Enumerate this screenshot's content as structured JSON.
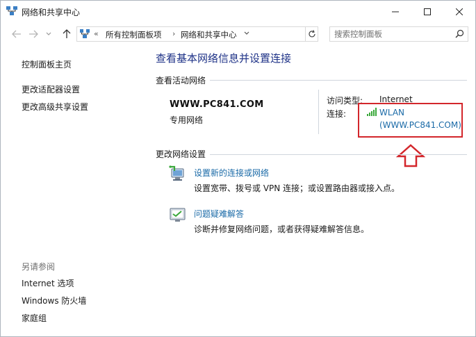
{
  "window": {
    "title": "网络和共享中心",
    "controls": [
      "minimize",
      "maximize",
      "close"
    ]
  },
  "address": {
    "overflow": "«",
    "crumbs": [
      "所有控制面板项",
      "网络和共享中心"
    ],
    "search_placeholder": "搜索控制面板"
  },
  "sidebar": {
    "home": "控制面板主页",
    "links": [
      "更改适配器设置",
      "更改高级共享设置"
    ],
    "see_also_label": "另请参阅",
    "see_also": [
      "Internet 选项",
      "Windows 防火墙",
      "家庭组"
    ]
  },
  "main": {
    "title": "查看基本网络信息并设置连接",
    "active_section": "查看活动网络",
    "network": {
      "name": "WWW.PC841.COM",
      "type": "专用网络",
      "access_label": "访问类型:",
      "access_value": "Internet",
      "connection_label": "连接:",
      "connection_name": "WLAN",
      "connection_ssid": "(WWW.PC841.COM)"
    },
    "change_section": "更改网络设置",
    "tasks": [
      {
        "link": "设置新的连接或网络",
        "desc": "设置宽带、拨号或 VPN 连接；或设置路由器或接入点。",
        "icon": "new-connection-icon"
      },
      {
        "link": "问题疑难解答",
        "desc": "诊断并修复网络问题，或者获得疑难解答信息。",
        "icon": "troubleshoot-icon"
      }
    ]
  },
  "colors": {
    "title_blue": "#1e3287",
    "link_blue": "#1a6aa7",
    "highlight_red": "#d3262b",
    "signal_green": "#3aa83a"
  }
}
